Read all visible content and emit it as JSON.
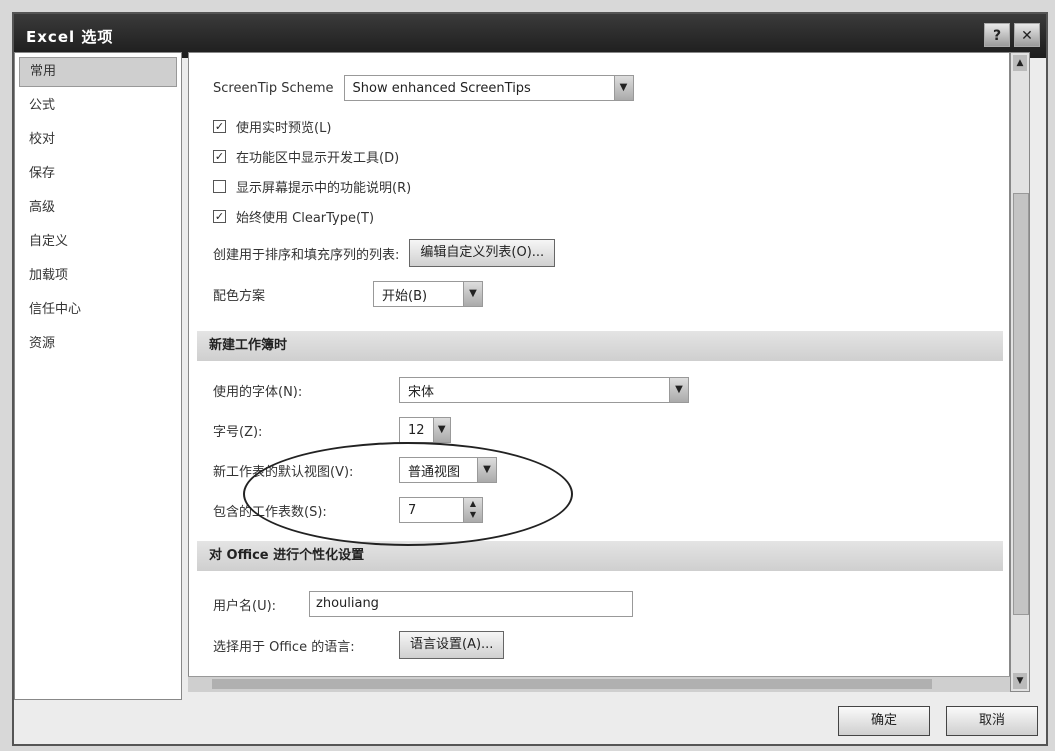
{
  "window": {
    "title": "Excel 选项",
    "help_glyph": "?",
    "close_glyph": "✕"
  },
  "nav": {
    "items": [
      {
        "label": "常用",
        "active": true
      },
      {
        "label": "公式"
      },
      {
        "label": "校对"
      },
      {
        "label": "保存"
      },
      {
        "label": "高级"
      },
      {
        "label": "自定义"
      },
      {
        "label": "加载项"
      },
      {
        "label": "信任中心"
      },
      {
        "label": "资源"
      }
    ]
  },
  "top_options": {
    "screentip_label": "ScreenTip Scheme",
    "screentip_value": "Show enhanced ScreenTips",
    "checkboxes": [
      {
        "label": "使用实时预览(L)",
        "checked": true
      },
      {
        "label": "在功能区中显示开发工具(D)",
        "checked": true
      },
      {
        "label": "显示屏幕提示中的功能说明(R)",
        "checked": false
      },
      {
        "label": "始终使用 ClearType(T)",
        "checked": true
      }
    ],
    "custom_list_label": "创建用于排序和填充序列的列表:",
    "custom_list_button": "编辑自定义列表(O)...",
    "color_scheme_label": "配色方案",
    "color_scheme_value": "开始(B)"
  },
  "new_workbook": {
    "heading": "新建工作簿时",
    "font_label": "使用的字体(N):",
    "font_value": "宋体",
    "size_label": "字号(Z):",
    "size_value": "12",
    "view_label": "新工作表的默认视图(V):",
    "view_value": "普通视图",
    "sheets_label": "包含的工作表数(S):",
    "sheets_value": "7"
  },
  "personalize": {
    "heading": "对 Office 进行个性化设置",
    "username_label": "用户名(U):",
    "username_value": "zhouliang",
    "language_label": "选择用于 Office 的语言:",
    "language_button": "语言设置(A)..."
  },
  "footer": {
    "ok": "确定",
    "cancel": "取消"
  }
}
